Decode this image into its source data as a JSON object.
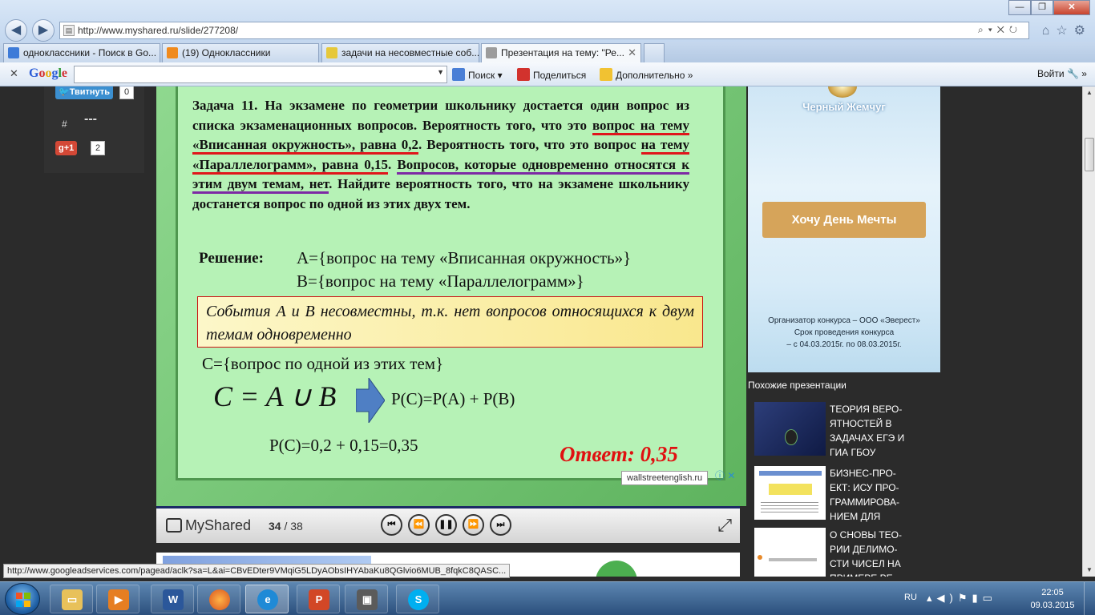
{
  "browser": {
    "url": "http://www.myshared.ru/slide/277208/",
    "url_domain": "myshared.ru",
    "tabs": [
      {
        "label": "одноклассники - Поиск в Go...",
        "color": "#3d7bd8"
      },
      {
        "label": "(19) Одноклассники",
        "color": "#f08a1c"
      },
      {
        "label": "задачи на несовместные соб...",
        "color": "#e6c83a"
      },
      {
        "label": "Презентация на тему: \"Ре...",
        "color": "#9c9c9c"
      }
    ],
    "toolbar": {
      "google_label": "Google",
      "search_label": "Поиск",
      "share_label": "Поделиться",
      "more_label": "Дополнительно",
      "signin_label": "Войти"
    }
  },
  "share": {
    "tweet_label": "Твитнуть",
    "tweet_count": "0",
    "hash": "#",
    "dashes": "---",
    "gplus_label": "g+1",
    "gplus_count": "2"
  },
  "slide": {
    "task_title": "Задача   11.",
    "task_text_1": " На экзамене по геометрии школьнику  достается один вопрос из списка экзаменационных  вопросов. Вероятность того, что это ",
    "task_red_1": "вопрос на тему «Вписанная окружность», равна 0,2",
    "task_text_2": ". Вероятность  того, что это вопрос ",
    "task_red_2": "на тему «Параллелограмм», равна 0,15",
    "task_text_3": ". ",
    "task_purple": "Вопросов, которые одновременно относятся к этим двум темам, нет",
    "task_text_4": ". Найдите вероятность  того, что на экзамене школьнику  достанется вопрос по одной из этих двух тем.",
    "solution_label": "Решение:",
    "event_a": "А={вопрос на тему «Вписанная окружность»}",
    "event_b": "В={вопрос на тему «Параллелограмм»}",
    "note": "События   А  и  В  несовместны,  т.к.  нет  вопросов относящихся  к двум темам   одновременно",
    "event_c": "С={вопрос по одной из этих тем}",
    "formula": "C = A ∪ B",
    "pc_sum": "Р(С)=Р(А) + Р(В)",
    "pc_value": "Р(С)=0,2 + 0,15=0,35",
    "answer": "Ответ: 0,35"
  },
  "player": {
    "brand": "MyShared",
    "current": "34",
    "total": "/ 38"
  },
  "ad": {
    "brand": "Черный Жемчуг",
    "cta": "Хочу День Мечты",
    "line1": "Организатор конкурса – ООО «Эверест»",
    "line2": "Срок проведения конкурса",
    "line3": "– с 04.03.2015г. по 08.03.2015г."
  },
  "below_ad": {
    "domain": "wallstreetenglish.ru",
    "controls": "ⓘ ✕"
  },
  "similar": {
    "title": "Похожие презентации",
    "items": [
      {
        "text": "ТЕОРИЯ ВЕРО-ЯТНОСТЕЙ В ЗАДАЧАХ ЕГЭ И ГИА ГБОУ"
      },
      {
        "text": "БИЗНЕС-ПРО-ЕКТ: ИСУ ПРО-ГРАММИРОВА-НИЕМ Для"
      },
      {
        "text": "О СНОВЫ ТЕО-РИИ ДЕЛИМО-СТИ ЧИСЕЛ На примере ре-"
      }
    ]
  },
  "status_url": "http://www.googleadservices.com/pagead/aclk?sa=L&ai=CBvEDter9VMqiG5LDyAObsIHYAbaKu8QGlvio6MUB_8fqkC8QASC...",
  "taskbar": {
    "lang": "RU",
    "time": "22:05",
    "date": "09.03.2015"
  }
}
